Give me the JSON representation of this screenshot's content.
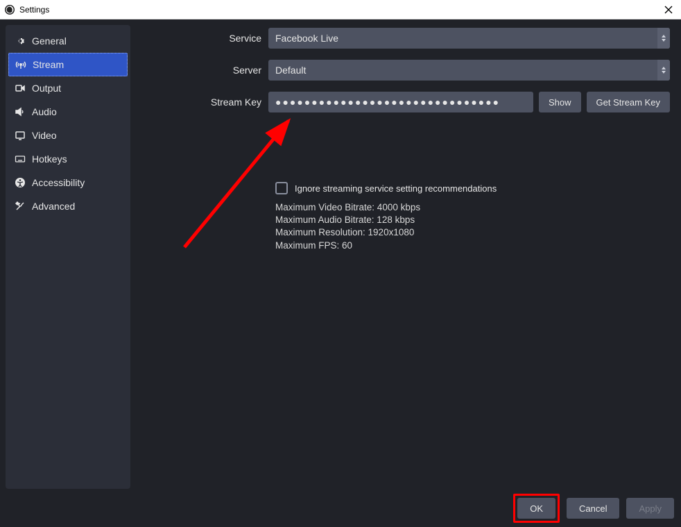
{
  "window": {
    "title": "Settings"
  },
  "sidebar": {
    "items": [
      {
        "label": "General"
      },
      {
        "label": "Stream"
      },
      {
        "label": "Output"
      },
      {
        "label": "Audio"
      },
      {
        "label": "Video"
      },
      {
        "label": "Hotkeys"
      },
      {
        "label": "Accessibility"
      },
      {
        "label": "Advanced"
      }
    ]
  },
  "form": {
    "service_label": "Service",
    "service_value": "Facebook Live",
    "server_label": "Server",
    "server_value": "Default",
    "streamkey_label": "Stream Key",
    "streamkey_value": "●●●●●●●●●●●●●●●●●●●●●●●●●●●●●●●",
    "show_button": "Show",
    "getkey_button": "Get Stream Key"
  },
  "recommendations": {
    "checkbox_label": "Ignore streaming service setting recommendations",
    "lines": {
      "video_bitrate": "Maximum Video Bitrate: 4000 kbps",
      "audio_bitrate": "Maximum Audio Bitrate: 128 kbps",
      "resolution": "Maximum Resolution: 1920x1080",
      "fps": "Maximum FPS: 60"
    }
  },
  "footer": {
    "ok": "OK",
    "cancel": "Cancel",
    "apply": "Apply"
  }
}
